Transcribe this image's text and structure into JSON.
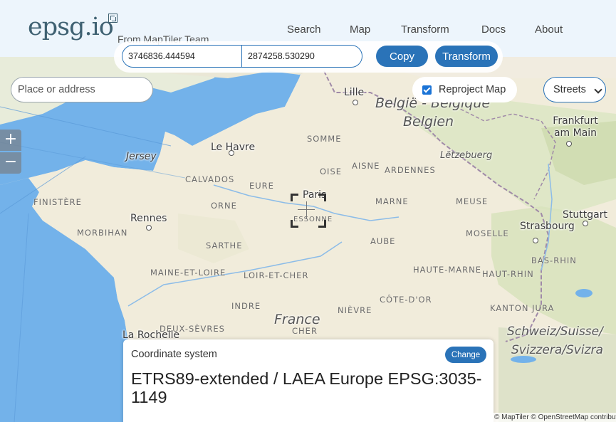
{
  "header": {
    "logo_text": "epsg.io",
    "tagline": "From MapTiler Team",
    "nav": [
      "Search",
      "Map",
      "Transform",
      "Docs",
      "About"
    ]
  },
  "transform_bar": {
    "x_value": "3746836.444594",
    "y_value": "2874258.530290",
    "copy_label": "Copy",
    "transform_label": "Transform"
  },
  "search": {
    "placeholder": "Place or address"
  },
  "reproject": {
    "label": "Reproject Map",
    "checked": true
  },
  "map_style": {
    "selected": "Streets"
  },
  "zoom": {
    "in_label": "+",
    "out_label": "−"
  },
  "map": {
    "cities": [
      "Lille",
      "Le Havre",
      "Paris",
      "Rennes",
      "Strasbourg",
      "Frankfurt am Main",
      "Stuttgart",
      "Jersey",
      "La Rochelle"
    ],
    "regions": [
      "SOMME",
      "AISNE",
      "OISE",
      "ARDENNES",
      "CALVADOS",
      "EURE",
      "MARNE",
      "FINISTÈRE",
      "ORNE",
      "MEUSE",
      "MORBIHAN",
      "SARTHE",
      "AUBE",
      "MOSELLE",
      "BAS-RHIN",
      "MAINE-ET-LOIRE",
      "LOIR-ET-CHER",
      "HAUTE-MARNE",
      "HAUT-RHIN",
      "INDRE",
      "CÔTE-D'OR",
      "NIÈVRE",
      "CHER",
      "DEUX-SÈVRES",
      "KANTON JURA",
      "ESSONNE"
    ],
    "countries": [
      "België - Belgique",
      "Belgien",
      "Lëtzebuerg",
      "France",
      "Schweiz/Suisse/",
      "Svizzera/Svizra"
    ]
  },
  "coordinate_system": {
    "heading": "Coordinate system",
    "change_label": "Change",
    "name": "ETRS89-extended / LAEA Europe EPSG:3035-1149"
  },
  "attribution": "© MapTiler © OpenStreetMap contributors",
  "colors": {
    "accent": "#2a73b8",
    "sea": "#6aaee8",
    "land": "#f2efe6"
  }
}
